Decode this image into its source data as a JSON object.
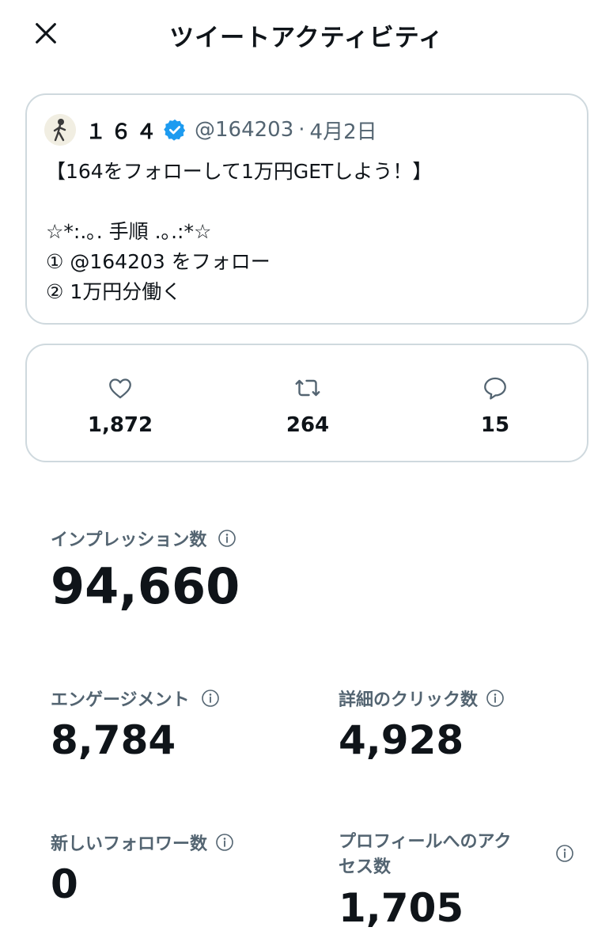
{
  "header": {
    "title": "ツイートアクティビティ",
    "close_icon": "close-icon"
  },
  "tweet": {
    "display_name": "１６４",
    "handle": "@164203",
    "separator": "·",
    "date": "4月2日",
    "lines": [
      "【164をフォローして1万円GETしよう！】",
      "",
      "☆*:.｡. 手順 .｡.:*☆",
      "① @164203 をフォロー",
      "② 1万円分働く"
    ]
  },
  "engagement": {
    "likes": "1,872",
    "retweets": "264",
    "replies": "15"
  },
  "metrics": {
    "impressions": {
      "label": "インプレッション数",
      "value": "94,660"
    },
    "engagements": {
      "label": "エンゲージメント",
      "value": "8,784"
    },
    "detail_clicks": {
      "label": "詳細のクリック数",
      "value": "4,928"
    },
    "new_followers": {
      "label": "新しいフォロワー数",
      "value": "0"
    },
    "profile_visits": {
      "label_line1": "プロフィールへのアク",
      "label_line2": "セス数",
      "value": "1,705"
    }
  },
  "colors": {
    "text": "#0f1419",
    "secondary": "#536471",
    "border": "#cfd9de",
    "verified": "#1d9bf0"
  }
}
